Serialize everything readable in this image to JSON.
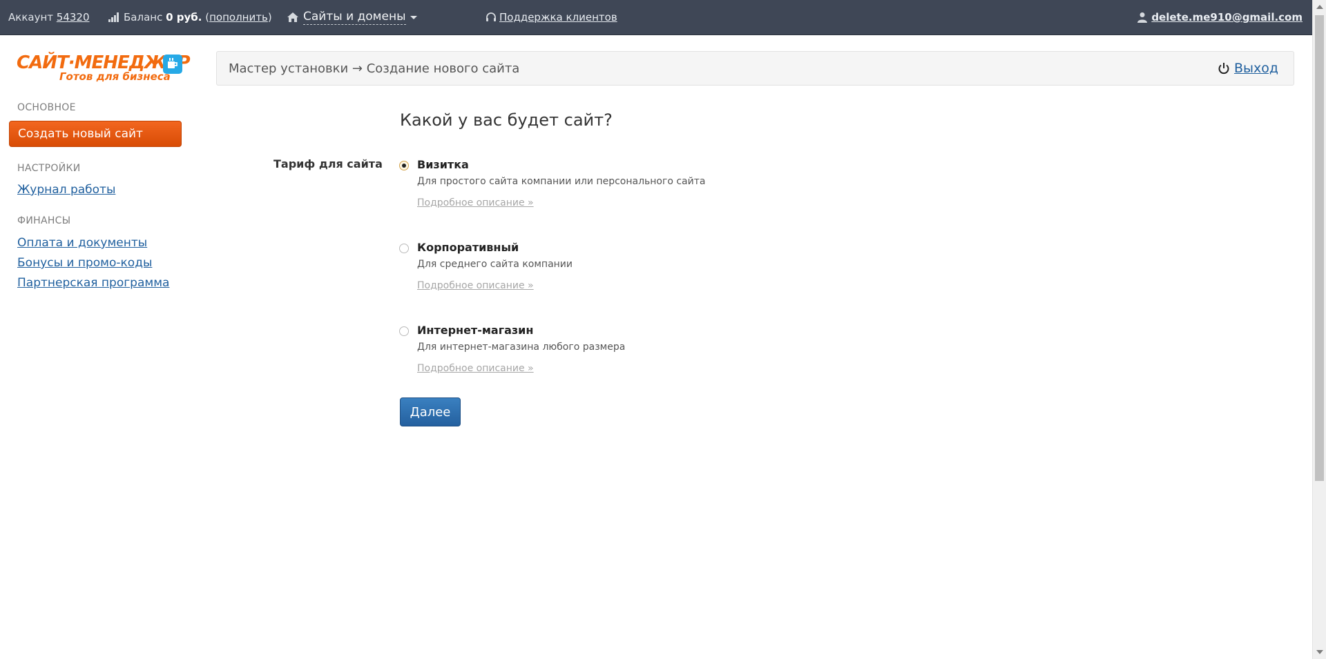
{
  "topbar": {
    "account_label": "Аккаунт",
    "account_number": "54320",
    "balance_label": "Баланс",
    "balance_value": "0 руб.",
    "topup_open": "(",
    "topup_link": "пополнить",
    "topup_close": ")",
    "sites_menu": "Сайты и домены",
    "support_link": "Поддержка клиентов",
    "user_email": "delete.me910@gmail.com"
  },
  "logo": {
    "title": "САЙТ·МЕНЕДЖЕР",
    "tagline": "Готов для бизнеса"
  },
  "sidebar": {
    "section_main": "Основное",
    "create_site": "Создать новый сайт",
    "section_settings": "Настройки",
    "work_log": "Журнал работы",
    "section_finance": "Финансы",
    "payments": "Оплата и документы",
    "bonuses": "Бонусы и промо-коды",
    "partner": "Партнерская программа"
  },
  "breadcrumb": {
    "path": "Мастер установки → Создание нового сайта",
    "logout": "Выход"
  },
  "main": {
    "title": "Какой у вас будет сайт?",
    "field_label": "Тариф для сайта",
    "options": [
      {
        "title": "Визитка",
        "desc": "Для простого сайта компании или персонального сайта",
        "more": "Подробное описание »",
        "checked": true
      },
      {
        "title": "Корпоративный",
        "desc": "Для среднего сайта компании",
        "more": "Подробное описание »",
        "checked": false
      },
      {
        "title": "Интернет-магазин",
        "desc": "Для интернет-магазина любого размера",
        "more": "Подробное описание »",
        "checked": false
      }
    ],
    "next_button": "Далее"
  },
  "colors": {
    "topbar_bg": "#3f4756",
    "accent_orange": "#e85a10",
    "primary_blue": "#2c6aa8",
    "link_blue": "#1f5f9e"
  }
}
